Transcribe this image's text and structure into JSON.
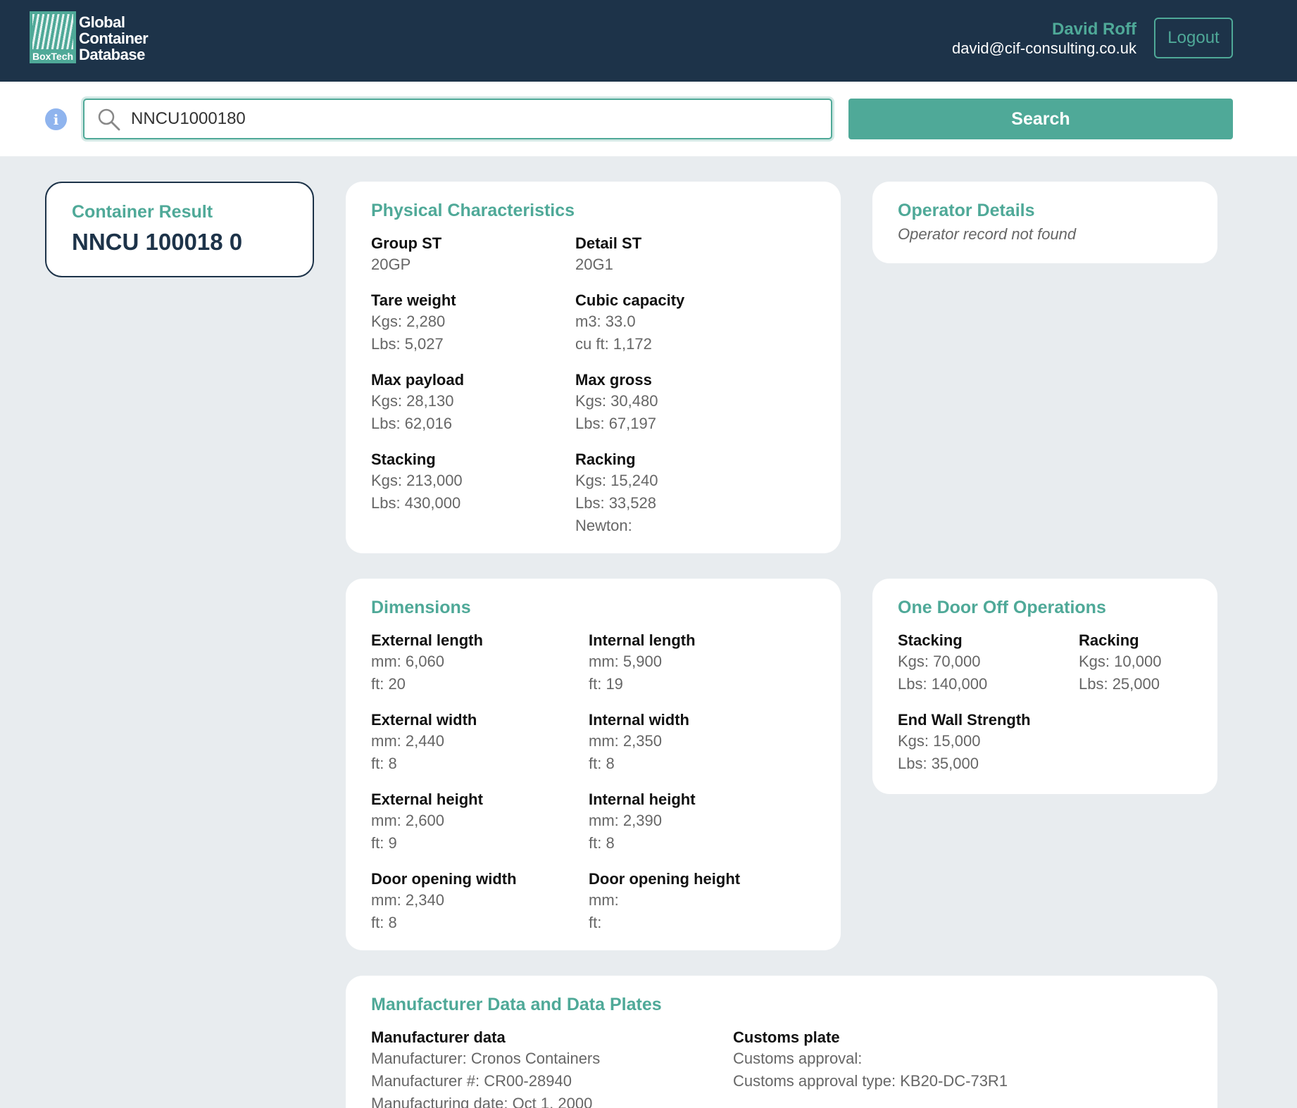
{
  "header": {
    "logo_badge": "BoxTech",
    "logo_line1": "Global",
    "logo_line2": "Container",
    "logo_line3": "Database",
    "user_name": "David Roff",
    "user_email": "david@cif-consulting.co.uk",
    "logout_label": "Logout"
  },
  "search": {
    "value": "NNCU1000180",
    "button_label": "Search",
    "info_symbol": "i"
  },
  "result": {
    "title": "Container Result",
    "value": "NNCU 100018 0"
  },
  "physical": {
    "title": "Physical Characteristics",
    "group_st": {
      "label": "Group ST",
      "v1": "20GP"
    },
    "detail_st": {
      "label": "Detail ST",
      "v1": "20G1"
    },
    "tare": {
      "label": "Tare weight",
      "v1": "Kgs: 2,280",
      "v2": "Lbs: 5,027"
    },
    "cubic": {
      "label": "Cubic capacity",
      "v1": "m3: 33.0",
      "v2": "cu ft: 1,172"
    },
    "payload": {
      "label": "Max payload",
      "v1": "Kgs: 28,130",
      "v2": "Lbs: 62,016"
    },
    "gross": {
      "label": "Max gross",
      "v1": "Kgs: 30,480",
      "v2": "Lbs: 67,197"
    },
    "stacking": {
      "label": "Stacking",
      "v1": "Kgs: 213,000",
      "v2": "Lbs: 430,000"
    },
    "racking": {
      "label": "Racking",
      "v1": "Kgs: 15,240",
      "v2": "Lbs: 33,528",
      "v3": "Newton:"
    }
  },
  "operator": {
    "title": "Operator Details",
    "message": "Operator record not found"
  },
  "dimensions": {
    "title": "Dimensions",
    "ext_length": {
      "label": "External length",
      "v1": "mm: 6,060",
      "v2": "ft: 20"
    },
    "int_length": {
      "label": "Internal length",
      "v1": "mm: 5,900",
      "v2": "ft: 19"
    },
    "ext_width": {
      "label": "External width",
      "v1": "mm: 2,440",
      "v2": "ft: 8"
    },
    "int_width": {
      "label": "Internal width",
      "v1": "mm: 2,350",
      "v2": "ft: 8"
    },
    "ext_height": {
      "label": "External height",
      "v1": "mm: 2,600",
      "v2": "ft: 9"
    },
    "int_height": {
      "label": "Internal height",
      "v1": "mm: 2,390",
      "v2": "ft: 8"
    },
    "door_width": {
      "label": "Door opening width",
      "v1": "mm: 2,340",
      "v2": "ft: 8"
    },
    "door_height": {
      "label": "Door opening height",
      "v1": "mm:",
      "v2": "ft:"
    }
  },
  "one_door_off": {
    "title": "One Door Off Operations",
    "stacking": {
      "label": "Stacking",
      "v1": "Kgs: 70,000",
      "v2": "Lbs: 140,000"
    },
    "racking": {
      "label": "Racking",
      "v1": "Kgs: 10,000",
      "v2": "Lbs: 25,000"
    },
    "end_wall": {
      "label": "End Wall Strength",
      "v1": "Kgs: 15,000",
      "v2": "Lbs: 35,000"
    }
  },
  "manufacturer": {
    "title": "Manufacturer Data and Data Plates",
    "mfr_data": {
      "label": "Manufacturer data",
      "v1": "Manufacturer: Cronos Containers",
      "v2": "Manufacturer #: CR00-28940",
      "v3": "Manufacturing date: Oct 1, 2000"
    },
    "customs": {
      "label": "Customs plate",
      "v1": "Customs approval:",
      "v2": "Customs approval type: KB20-DC-73R1"
    }
  },
  "colors": {
    "header_bg": "#1d3349",
    "accent": "#4fa998",
    "page_bg": "#e8ecef"
  }
}
